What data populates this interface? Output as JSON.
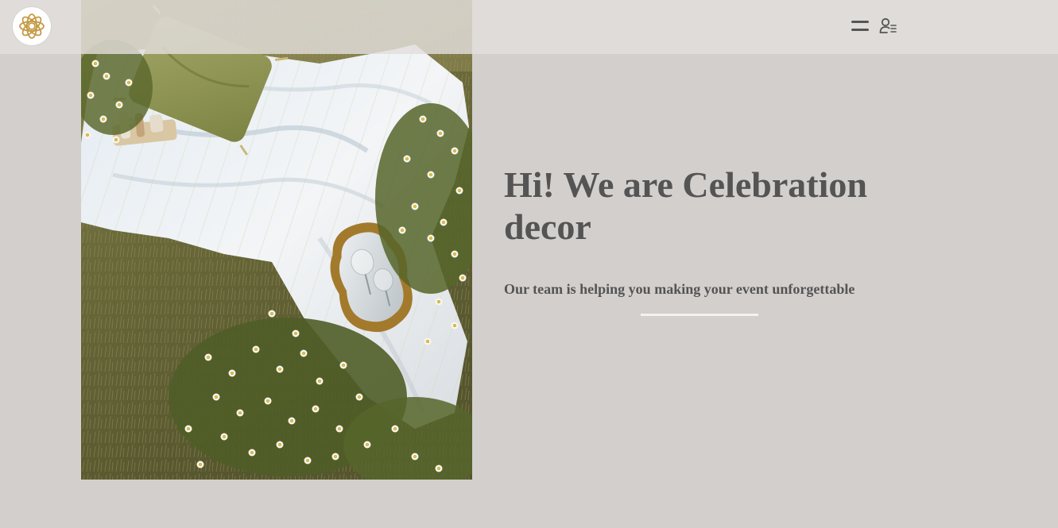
{
  "header": {
    "logo_icon": "floral-mandala-logo-icon",
    "menu_icon": "hamburger-menu-icon",
    "account_icon": "user-list-icon"
  },
  "hero": {
    "image_subject": "picnic-blanket-with-pillow-mirror-and-chamomile-flowers",
    "title": "Hi! We are Celebration decor",
    "subtitle": "Our team is helping you making your event unforgettable"
  },
  "colors": {
    "background": "#d3cfcd",
    "header_bar": "#e2dedc",
    "text": "#545454",
    "divider": "#f4f2f1",
    "logo_gold": "#c59a45"
  }
}
